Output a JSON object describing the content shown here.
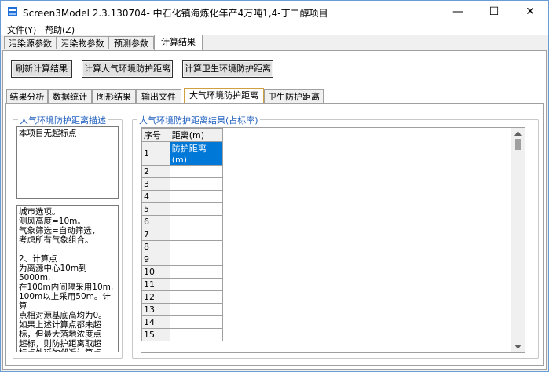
{
  "window": {
    "title": "Screen3Model 2.3.130704- 中石化镇海炼化年产4万吨1,4-丁二醇项目",
    "min_symbol": "—",
    "max_symbol": "☐",
    "close_symbol": "✕"
  },
  "menu": [
    {
      "label": "文件(Y)"
    },
    {
      "label": "帮助(Z)"
    }
  ],
  "top_tabs": [
    {
      "label": "污染源参数"
    },
    {
      "label": "污染物参数"
    },
    {
      "label": "预测参数"
    },
    {
      "label": "计算结果"
    }
  ],
  "toolbar": {
    "refresh_label": "刷新计算结果",
    "atmo_label": "计算大气环境防护距离",
    "health_label": "计算卫生环境防护距离"
  },
  "sub_tabs": [
    {
      "label": "结果分析"
    },
    {
      "label": "数据统计"
    },
    {
      "label": "图形结果"
    },
    {
      "label": "输出文件"
    },
    {
      "label": "大气环境防护距离"
    },
    {
      "label": "卫生防护距离"
    }
  ],
  "left_group": {
    "title": "大气环境防护距离描述",
    "summary": "本项目无超标点",
    "details": "城市选项。\n测风高度=10m。\n气象筛选=自动筛选，\n考虑所有气象组合。\n\n2、计算点\n为离源中心10m到5000m,\n在100m内间隔采用10m,\n100m以上采用50m。计算\n点相对源基底高均为0。\n如果上述计算点都未超\n标，但最大落地浓度点\n超标，则防护距离取超\n标点外延的邻近计算点。"
  },
  "right_group": {
    "title": "大气环境防护距离结果(占标率)",
    "col_seq": "序号",
    "col_dist": "距离(m)",
    "selected_cell": "防护距离(m)",
    "rows": [
      "1",
      "2",
      "3",
      "4",
      "5",
      "6",
      "7",
      "8",
      "9",
      "10",
      "11",
      "12",
      "13",
      "14",
      "15"
    ]
  },
  "colors": {
    "accent": "#0078d7",
    "group_title": "#1f5fbf"
  }
}
